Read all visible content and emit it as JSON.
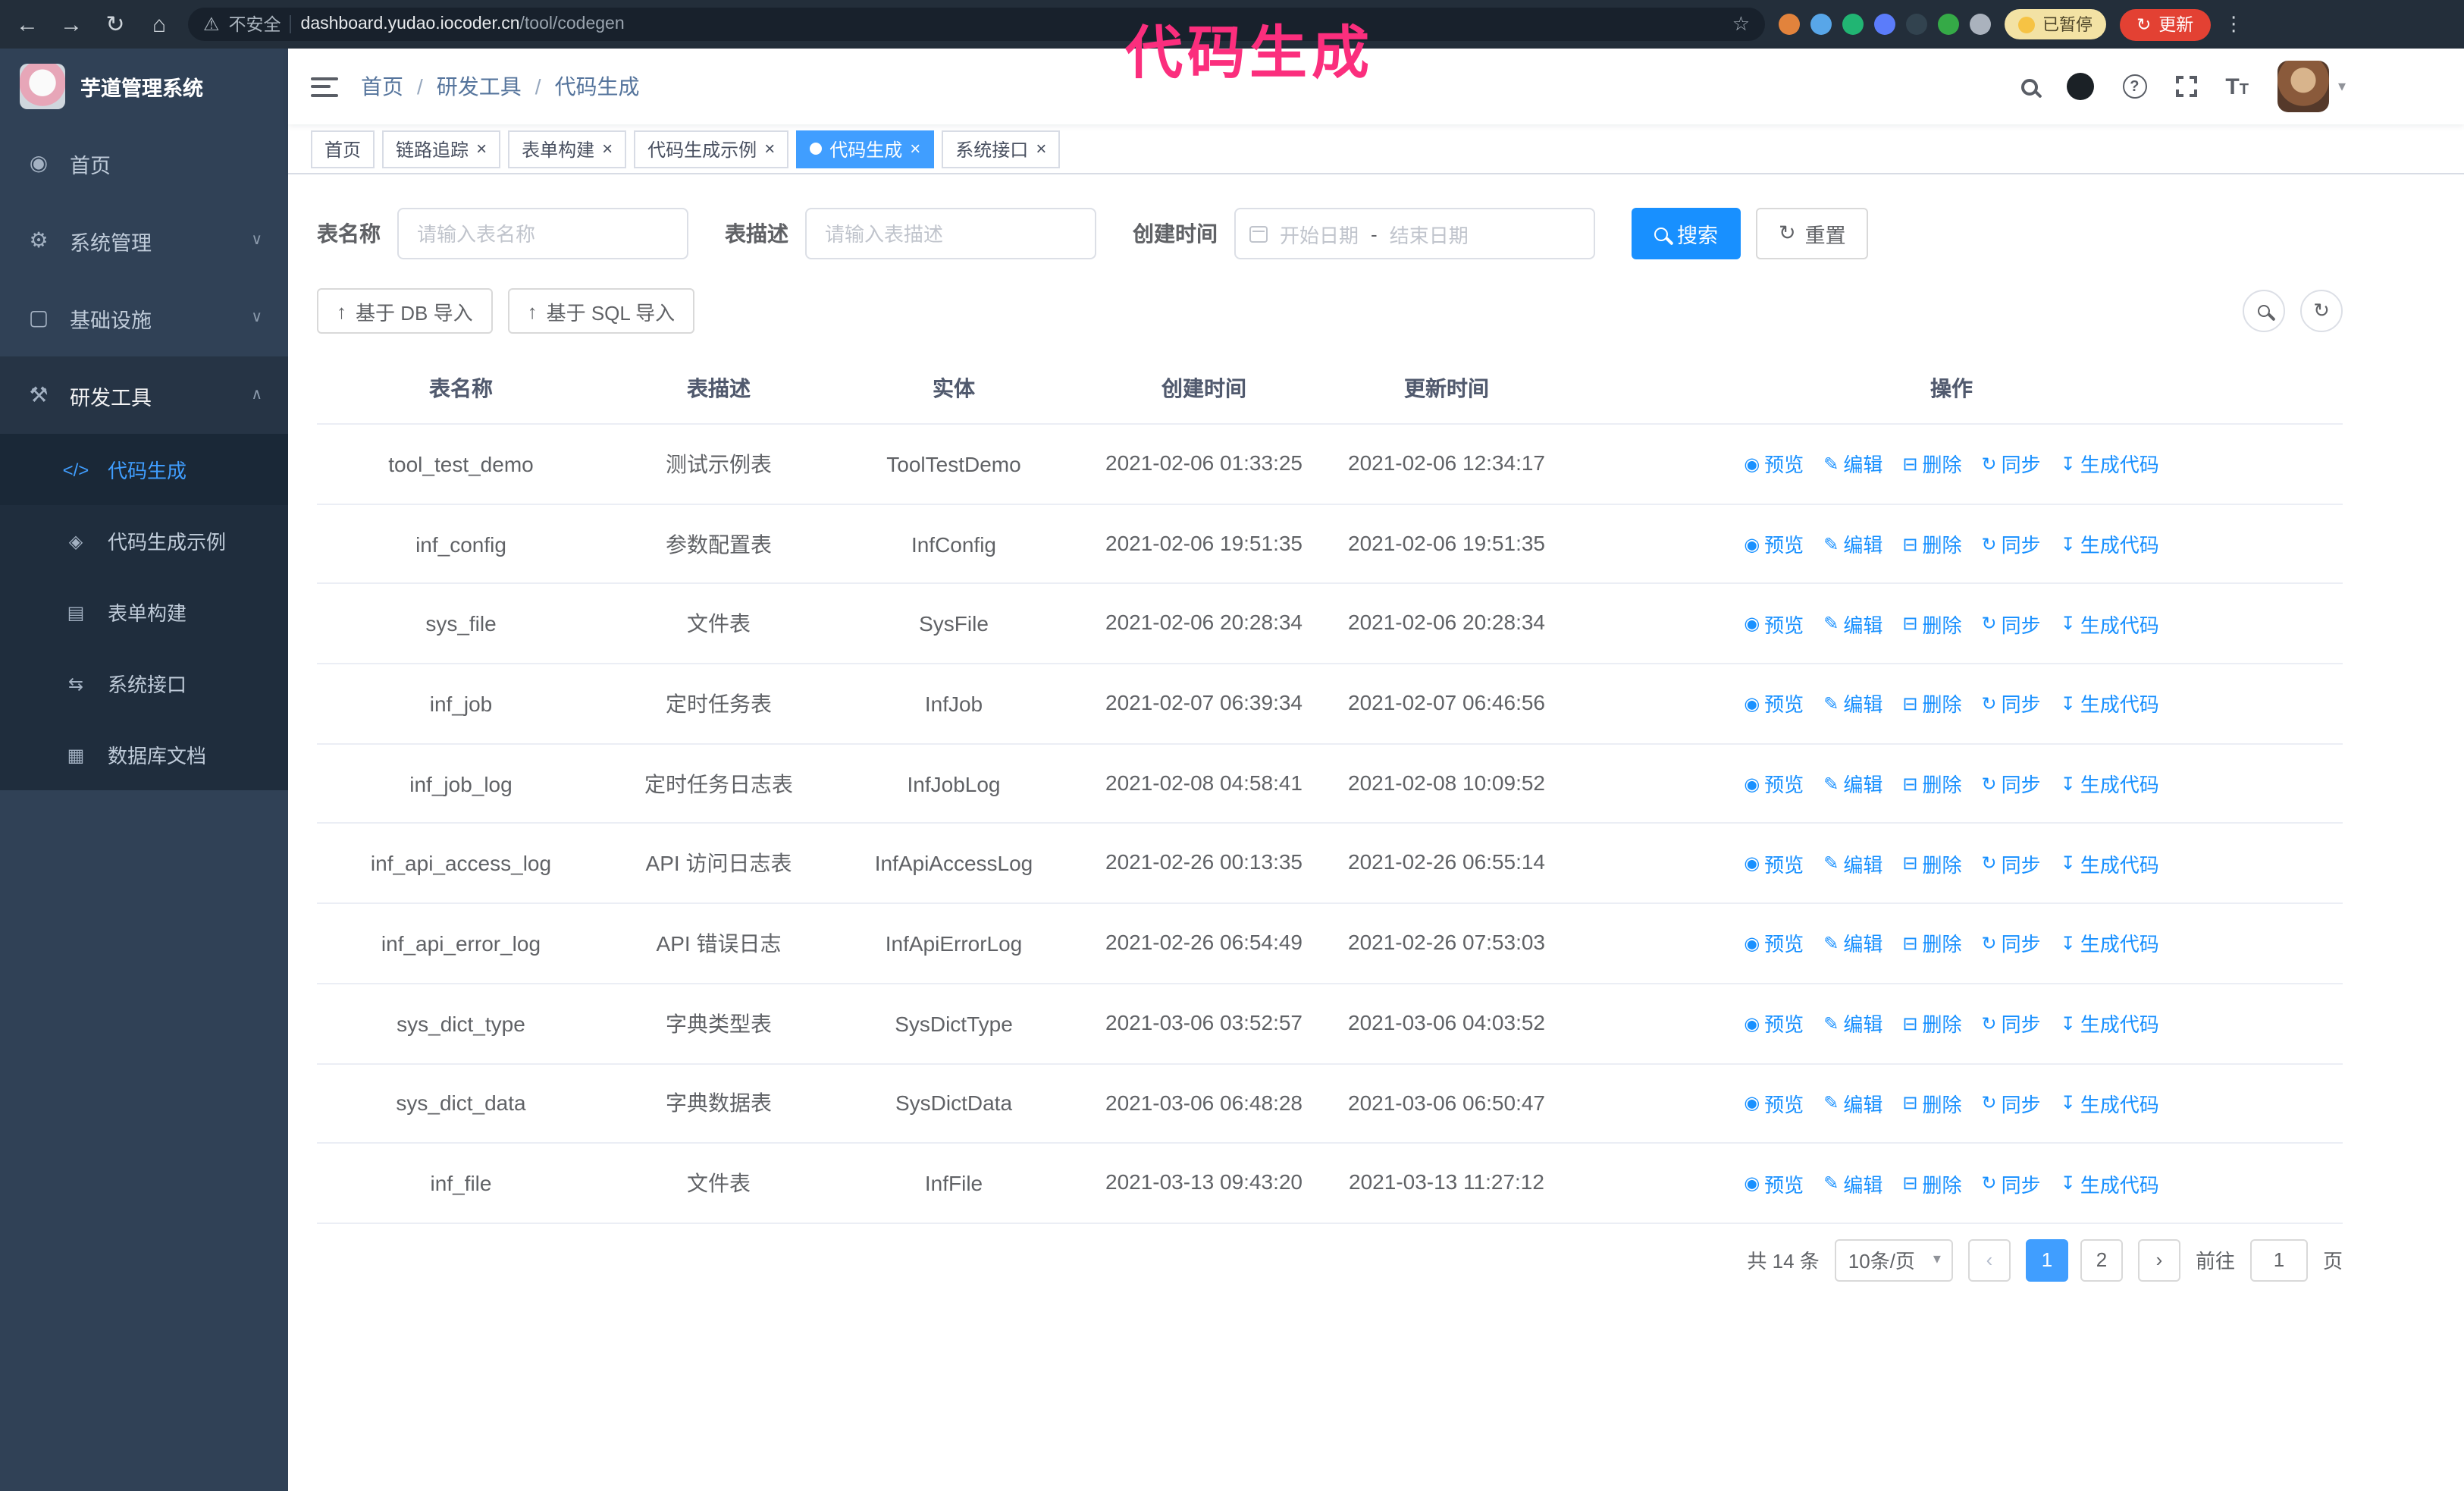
{
  "browser": {
    "security_label": "不安全",
    "url_host": "dashboard.yudao.iocoder.cn",
    "url_path": "/tool/codegen",
    "paused_label": "已暂停",
    "update_label": "更新",
    "extensions": [
      {
        "color": "#e2833c"
      },
      {
        "color": "#58a6e8"
      },
      {
        "color": "#21b573"
      },
      {
        "color": "#5b7cfa"
      },
      {
        "color": "#32434f"
      },
      {
        "color": "#35aa47"
      },
      {
        "color": "#aab2bd"
      }
    ]
  },
  "annotation": {
    "text": "代码生成"
  },
  "sidebar": {
    "logo_title": "芋道管理系统",
    "items": [
      {
        "icon": "dashboard",
        "label": "首页",
        "chevron": ""
      },
      {
        "icon": "gear",
        "label": "系统管理",
        "chevron": "down"
      },
      {
        "icon": "infrastructure",
        "label": "基础设施",
        "chevron": "down"
      },
      {
        "icon": "tools",
        "label": "研发工具",
        "chevron": "up"
      }
    ],
    "subitems": [
      {
        "icon": "code",
        "label": "代码生成",
        "active": true
      },
      {
        "icon": "example",
        "label": "代码生成示例",
        "active": false
      },
      {
        "icon": "form",
        "label": "表单构建",
        "active": false
      },
      {
        "icon": "api",
        "label": "系统接口",
        "active": false
      },
      {
        "icon": "database",
        "label": "数据库文档",
        "active": false
      }
    ]
  },
  "header": {
    "breadcrumb": [
      "首页",
      "研发工具",
      "代码生成"
    ],
    "separator": "/"
  },
  "tabs": [
    {
      "label": "首页",
      "closable": false,
      "active": false
    },
    {
      "label": "链路追踪",
      "closable": true,
      "active": false
    },
    {
      "label": "表单构建",
      "closable": true,
      "active": false
    },
    {
      "label": "代码生成示例",
      "closable": true,
      "active": false
    },
    {
      "label": "代码生成",
      "closable": true,
      "active": true
    },
    {
      "label": "系统接口",
      "closable": true,
      "active": false
    }
  ],
  "filters": {
    "table_name_label": "表名称",
    "table_name_placeholder": "请输入表名称",
    "table_desc_label": "表描述",
    "table_desc_placeholder": "请输入表描述",
    "create_time_label": "创建时间",
    "start_date_placeholder": "开始日期",
    "range_separator": "-",
    "end_date_placeholder": "结束日期",
    "search_label": "搜索",
    "reset_label": "重置"
  },
  "toolbar": {
    "import_db_label": "基于 DB 导入",
    "import_sql_label": "基于 SQL 导入"
  },
  "table": {
    "columns": [
      "表名称",
      "表描述",
      "实体",
      "创建时间",
      "更新时间",
      "操作"
    ],
    "actions": [
      {
        "key": "preview",
        "icon": "eye",
        "label": "预览"
      },
      {
        "key": "edit",
        "icon": "edit",
        "label": "编辑"
      },
      {
        "key": "delete",
        "icon": "delete",
        "label": "删除"
      },
      {
        "key": "sync",
        "icon": "sync",
        "label": "同步"
      },
      {
        "key": "generate",
        "icon": "generate",
        "label": "生成代码"
      }
    ],
    "rows": [
      {
        "name": "tool_test_demo",
        "desc": "测试示例表",
        "entity": "ToolTestDemo",
        "created": "2021-02-06 01:33:25",
        "updated": "2021-02-06 12:34:17"
      },
      {
        "name": "inf_config",
        "desc": "参数配置表",
        "entity": "InfConfig",
        "created": "2021-02-06 19:51:35",
        "updated": "2021-02-06 19:51:35"
      },
      {
        "name": "sys_file",
        "desc": "文件表",
        "entity": "SysFile",
        "created": "2021-02-06 20:28:34",
        "updated": "2021-02-06 20:28:34"
      },
      {
        "name": "inf_job",
        "desc": "定时任务表",
        "entity": "InfJob",
        "created": "2021-02-07 06:39:34",
        "updated": "2021-02-07 06:46:56"
      },
      {
        "name": "inf_job_log",
        "desc": "定时任务日志表",
        "entity": "InfJobLog",
        "created": "2021-02-08 04:58:41",
        "updated": "2021-02-08 10:09:52"
      },
      {
        "name": "inf_api_access_log",
        "desc": "API 访问日志表",
        "entity": "InfApiAccessLog",
        "created": "2021-02-26 00:13:35",
        "updated": "2021-02-26 06:55:14"
      },
      {
        "name": "inf_api_error_log",
        "desc": "API 错误日志",
        "entity": "InfApiErrorLog",
        "created": "2021-02-26 06:54:49",
        "updated": "2021-02-26 07:53:03"
      },
      {
        "name": "sys_dict_type",
        "desc": "字典类型表",
        "entity": "SysDictType",
        "created": "2021-03-06 03:52:57",
        "updated": "2021-03-06 04:03:52"
      },
      {
        "name": "sys_dict_data",
        "desc": "字典数据表",
        "entity": "SysDictData",
        "created": "2021-03-06 06:48:28",
        "updated": "2021-03-06 06:50:47"
      },
      {
        "name": "inf_file",
        "desc": "文件表",
        "entity": "InfFile",
        "created": "2021-03-13 09:43:20",
        "updated": "2021-03-13 11:27:12"
      }
    ]
  },
  "pagination": {
    "total_label": "共 14 条",
    "page_size_label": "10条/页",
    "pages": [
      "1",
      "2"
    ],
    "current_page": "1",
    "goto_prefix": "前往",
    "goto_value": "1",
    "goto_suffix": "页"
  },
  "icons": {
    "dashboard": "◉",
    "gear": "⚙",
    "infrastructure": "▢",
    "tools": "⚒",
    "code": "</>",
    "example": "◈",
    "form": "▤",
    "api": "⇆",
    "database": "▦",
    "chevron_down": "∨",
    "chevron_up": "∧",
    "eye": "◉",
    "edit": "✎",
    "delete": "⊟",
    "sync": "↻",
    "generate": "↧",
    "upload": "↑",
    "refresh": "↻",
    "back": "←",
    "forward": "→",
    "reload": "↻",
    "home": "⌂",
    "warning": "⚠",
    "star": "☆",
    "dots": "⋮",
    "caret_down": "▾",
    "prev": "‹",
    "next": "›"
  },
  "colors": {
    "primary": "#409eff",
    "link": "#1890ff",
    "annotation": "#fb2e7d",
    "sidebar_bg": "#304156",
    "submenu_bg": "#1f2d3d",
    "update_button": "#e34133",
    "paused_badge": "#f3e2a4",
    "browser_bar": "#232e3a"
  }
}
